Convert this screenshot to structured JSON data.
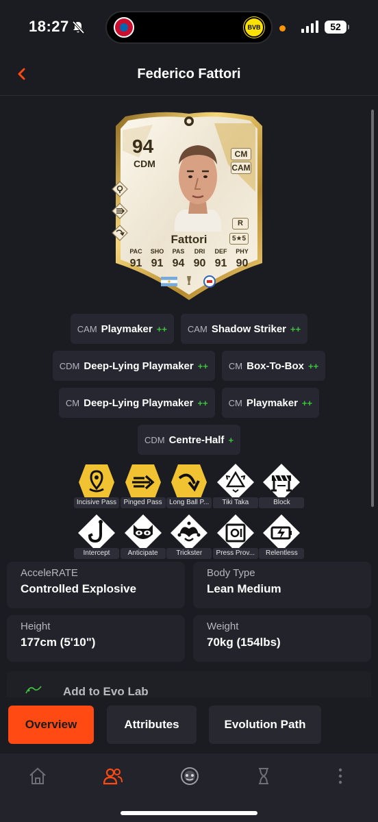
{
  "status": {
    "time": "18:27",
    "battery": "52",
    "club_left": "bayern-munich-crest",
    "club_right": "bvb-crest",
    "club_right_text": "BVB"
  },
  "header": {
    "title": "Federico Fattori",
    "back_icon": "chevron-left-icon"
  },
  "card": {
    "rating": "94",
    "position": "CDM",
    "alt_positions": [
      "CM",
      "CAM"
    ],
    "foot": "R",
    "skill_weak": "5★5",
    "name": "Fattori",
    "stats": [
      {
        "label": "PAC",
        "value": "91"
      },
      {
        "label": "SHO",
        "value": "91"
      },
      {
        "label": "PAS",
        "value": "94"
      },
      {
        "label": "DRI",
        "value": "90"
      },
      {
        "label": "DEF",
        "value": "91"
      },
      {
        "label": "PHY",
        "value": "90"
      }
    ],
    "nation": "argentina-flag",
    "club": "club-crest"
  },
  "roles": [
    [
      {
        "pos": "CAM",
        "name": "Playmaker",
        "plus": "++"
      },
      {
        "pos": "CAM",
        "name": "Shadow Striker",
        "plus": "++"
      }
    ],
    [
      {
        "pos": "CDM",
        "name": "Deep-Lying Playmaker",
        "plus": "++"
      },
      {
        "pos": "CM",
        "name": "Box-To-Box",
        "plus": "++"
      }
    ],
    [
      {
        "pos": "CM",
        "name": "Deep-Lying Playmaker",
        "plus": "++"
      },
      {
        "pos": "CM",
        "name": "Playmaker",
        "plus": "++"
      }
    ],
    [
      {
        "pos": "CDM",
        "name": "Centre-Half",
        "plus": "+"
      }
    ]
  ],
  "playstyles": [
    [
      {
        "label": "Incisive Pass",
        "plus": true,
        "icon": "location-pin-icon"
      },
      {
        "label": "Pinged Pass",
        "plus": true,
        "icon": "fast-arrow-icon"
      },
      {
        "label": "Long Ball P...",
        "plus": true,
        "icon": "curved-arrow-icon"
      },
      {
        "label": "Tiki Taka",
        "plus": false,
        "icon": "triangle-arrows-icon"
      },
      {
        "label": "Block",
        "plus": false,
        "icon": "barrier-icon"
      }
    ],
    [
      {
        "label": "Intercept",
        "plus": false,
        "icon": "hook-icon"
      },
      {
        "label": "Anticipate",
        "plus": false,
        "icon": "raccoon-icon"
      },
      {
        "label": "Trickster",
        "plus": false,
        "icon": "jester-icon"
      },
      {
        "label": "Press Prov...",
        "plus": false,
        "icon": "safe-icon"
      },
      {
        "label": "Relentless",
        "plus": false,
        "icon": "battery-bolt-icon"
      }
    ]
  ],
  "info": {
    "accelerate_label": "AcceleRATE",
    "accelerate_value": "Controlled Explosive",
    "body_label": "Body Type",
    "body_value": "Lean Medium",
    "height_label": "Height",
    "height_value": "177cm (5'10\")",
    "weight_label": "Weight",
    "weight_value": "70kg (154lbs)"
  },
  "evo": {
    "label": "Add to Evo Lab",
    "icon": "evo-lab-icon"
  },
  "tabs": {
    "overview": "Overview",
    "attributes": "Attributes",
    "evolution": "Evolution Path",
    "active": "Overview"
  },
  "colors": {
    "accent": "#ff4a14",
    "plus_green": "#3ec43e",
    "gold": "#f1c232",
    "background": "#1b1c22"
  },
  "nav": {
    "items": [
      "home-icon",
      "players-icon",
      "club-icon",
      "evolutions-icon",
      "more-icon"
    ],
    "active": "players-icon"
  }
}
